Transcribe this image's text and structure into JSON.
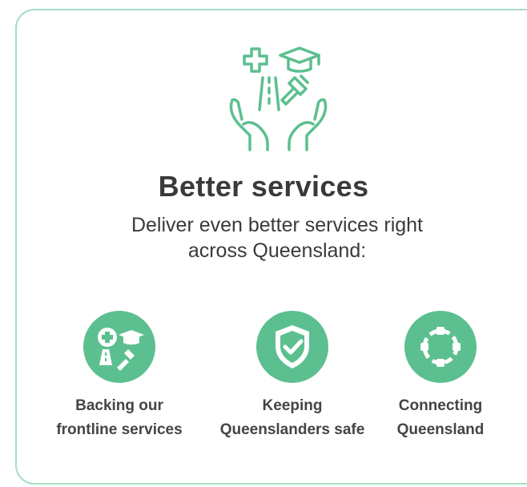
{
  "heading": {
    "title": "Better services",
    "subtitle_line1": "Deliver even better services right",
    "subtitle_line2": "across Queensland:"
  },
  "items": [
    {
      "line1": "Backing our",
      "line2": "frontline services",
      "icon": "health-education-justice-icon"
    },
    {
      "line1": "Keeping",
      "line2": "Queenslanders safe",
      "icon": "shield-check-icon"
    },
    {
      "line1": "Connecting",
      "line2": "Queensland",
      "icon": "circle-nodes-icon"
    }
  ],
  "colors": {
    "accent": "#5cbf8f",
    "border": "#a8dcc6",
    "text": "#3a3a3a"
  }
}
